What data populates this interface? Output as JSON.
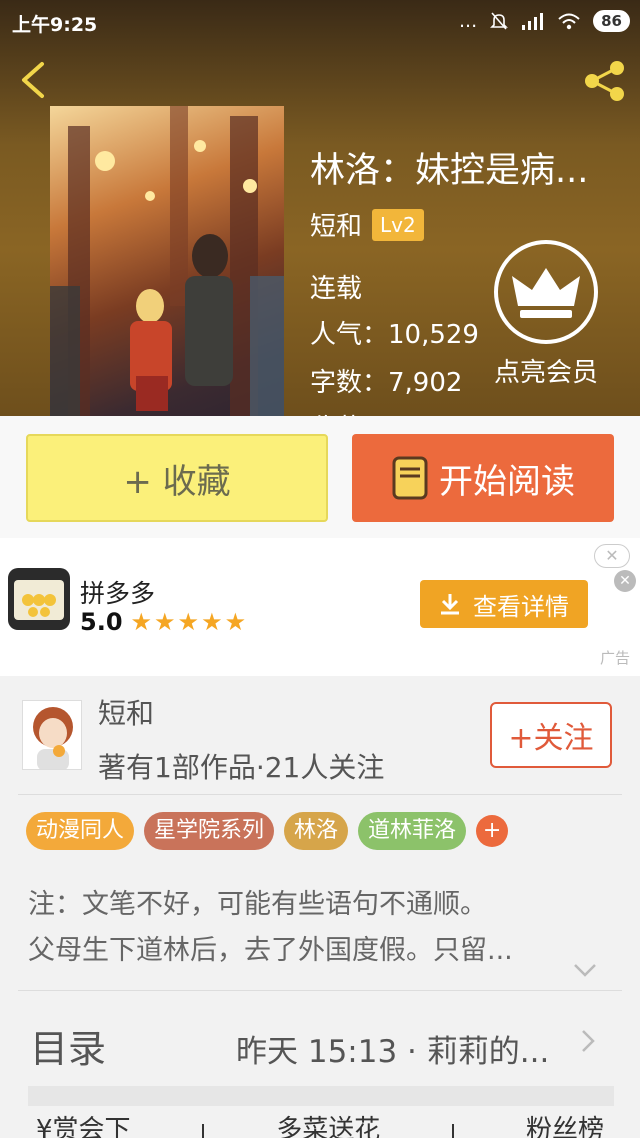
{
  "status_bar": {
    "time": "上午9:25",
    "battery": "86",
    "dots": "..."
  },
  "book": {
    "title": "林洛：妹控是病...",
    "author": "短和",
    "author_level": "Lv2",
    "status": "连载",
    "popularity": "人气：10,529",
    "word_count": "字数：7,902",
    "collections_partial": "收藏：..."
  },
  "vip": {
    "label": "点亮会员"
  },
  "actions": {
    "collect_label": "+ 收藏",
    "read_label": "开始阅读"
  },
  "ad": {
    "app_name": "拼多多",
    "rating": "5.0",
    "stars": "★★★★★",
    "button_label": "查看详情",
    "ad_label": "广告",
    "close_glyph": "✕"
  },
  "author_card": {
    "name": "短和",
    "stats": "著有1部作品·21人关注",
    "follow_label": "+关注"
  },
  "tags": [
    {
      "label": "动漫同人",
      "color": "#f3a93a"
    },
    {
      "label": "星学院系列",
      "color": "#c9735a"
    },
    {
      "label": "林洛",
      "color": "#d6a54a"
    },
    {
      "label": "道林菲洛",
      "color": "#8cc26a"
    }
  ],
  "tag_more": "+",
  "description": {
    "line1": "注：文笔不好，可能有些语句不通顺。",
    "line2": "父母生下道林后，去了外国度假。只留..."
  },
  "toc": {
    "title": "目录",
    "latest": "昨天 15:13 · 莉莉的..."
  },
  "bottom_tabs": [
    "¥赏会下",
    "多菜送花",
    "粉丝榜"
  ],
  "colors": {
    "accent": "#ec6a3d",
    "collect": "#fbf07a",
    "vip_level": "#f2b63a"
  }
}
